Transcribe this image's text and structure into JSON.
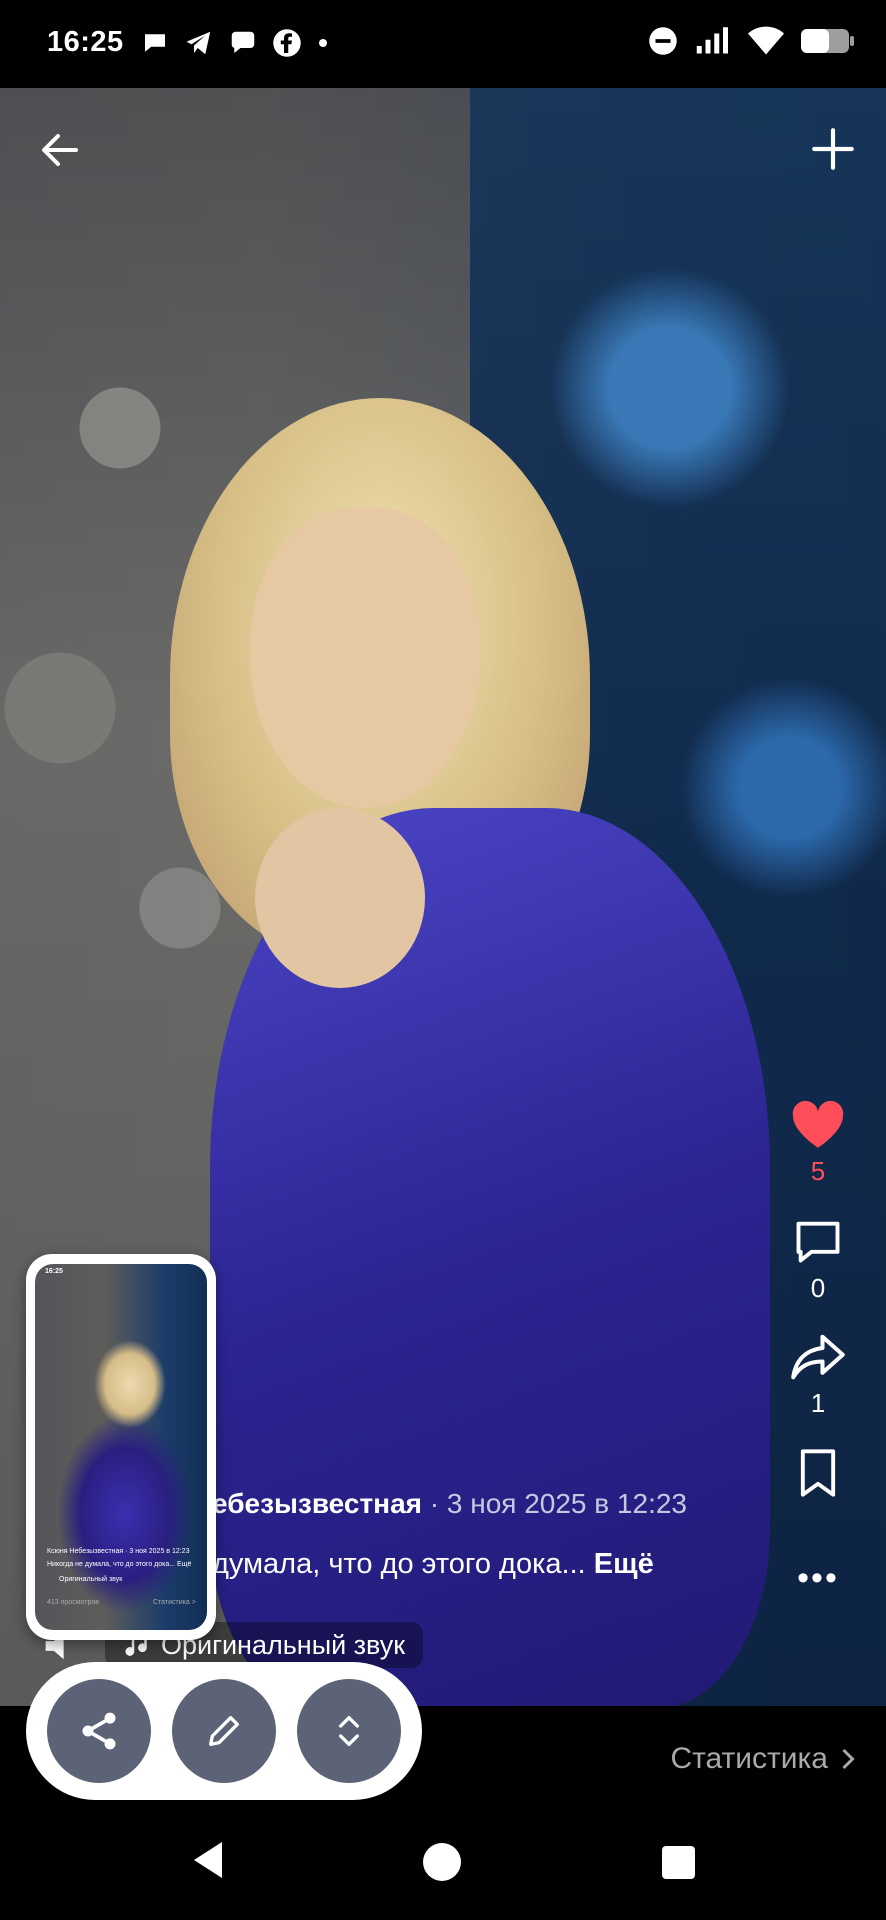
{
  "status_bar": {
    "time": "16:25",
    "left_icons": [
      "chat-icon",
      "telegram-icon",
      "message-icon",
      "facebook-icon",
      "dot-icon"
    ],
    "right_icons": [
      "do-not-disturb-icon",
      "signal-icon",
      "wifi-icon",
      "battery-icon"
    ]
  },
  "post": {
    "author": "Ксюня Небезызвестная",
    "author_visible": "ебезызвестная",
    "date": "3 ноя 2025 в 12:23",
    "separator": "·",
    "caption_visible": "думала, что до этого дока...",
    "caption_more": "Ещё",
    "sound_label": "Оригинальный звук"
  },
  "actions": {
    "likes": "5",
    "comments": "0",
    "shares": "1"
  },
  "bottom": {
    "stats_label": "Статистика"
  },
  "pip": {
    "author_line": "Ксюня Небезызвестная · 3 ноя 2025 в 12:23",
    "caption_line": "Никогда не думала, что до этого дока... Ещё",
    "sound_line": "Оригинальный звук",
    "views_line": "413 просмотров",
    "stats_line": "Статистика >",
    "status_time": "16:25"
  },
  "colors": {
    "like_red": "#ff4d5a",
    "toolbar_button": "#5c6376",
    "stats_gray": "#a9a9a9"
  }
}
